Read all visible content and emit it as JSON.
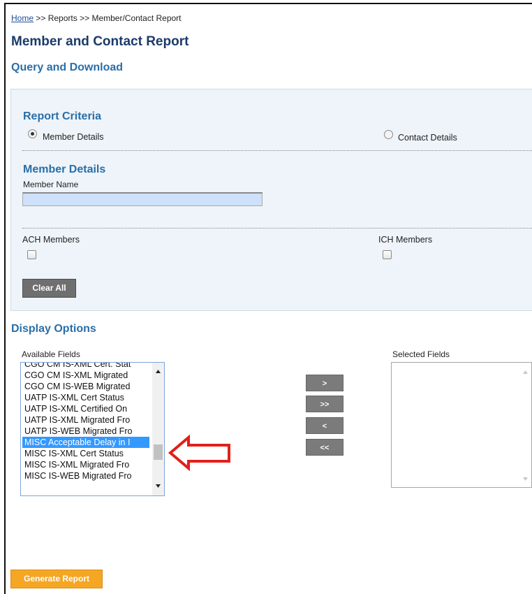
{
  "breadcrumb": {
    "home": "Home",
    "sep1": ">>",
    "reports": "Reports",
    "sep2": ">>",
    "current": "Member/Contact Report"
  },
  "page_title": "Member and Contact Report",
  "section_title": "Query and Download",
  "report_criteria": {
    "title": "Report Criteria",
    "options": [
      {
        "label": "Member Details",
        "checked": true
      },
      {
        "label": "Contact Details",
        "checked": false
      }
    ]
  },
  "member_details": {
    "title": "Member Details",
    "member_name_label": "Member Name",
    "member_name_value": ""
  },
  "membership": {
    "ach_label": "ACH Members",
    "ach_checked": false,
    "ich_label": "ICH Members",
    "ich_checked": false
  },
  "clear_all_label": "Clear All",
  "display_options": {
    "title": "Display Options",
    "available_label": "Available Fields",
    "selected_label": "Selected Fields",
    "available_fields": [
      "CGO CM IS-XML Cert. Stat",
      "CGO CM IS-XML Migrated",
      "CGO CM IS-WEB Migrated",
      "UATP IS-XML Cert Status",
      "UATP IS-XML Certified On",
      "UATP IS-XML Migrated Fro",
      "UATP IS-WEB Migrated Fro",
      "MISC Acceptable Delay in I",
      "MISC IS-XML Cert Status",
      "MISC IS-XML Migrated Fro",
      "MISC IS-WEB Migrated Fro"
    ],
    "selected_index": 7,
    "selected_fields": [],
    "move_buttons": [
      ">",
      ">>",
      "<",
      "<<"
    ]
  },
  "generate_report_label": "Generate Report",
  "colors": {
    "title": "#1b3a6b",
    "section": "#2a6ea8",
    "panel_bg": "#eef4f9",
    "list_selected": "#3399ff",
    "generate_button": "#f5a623",
    "annotation_arrow": "#e0201b"
  }
}
